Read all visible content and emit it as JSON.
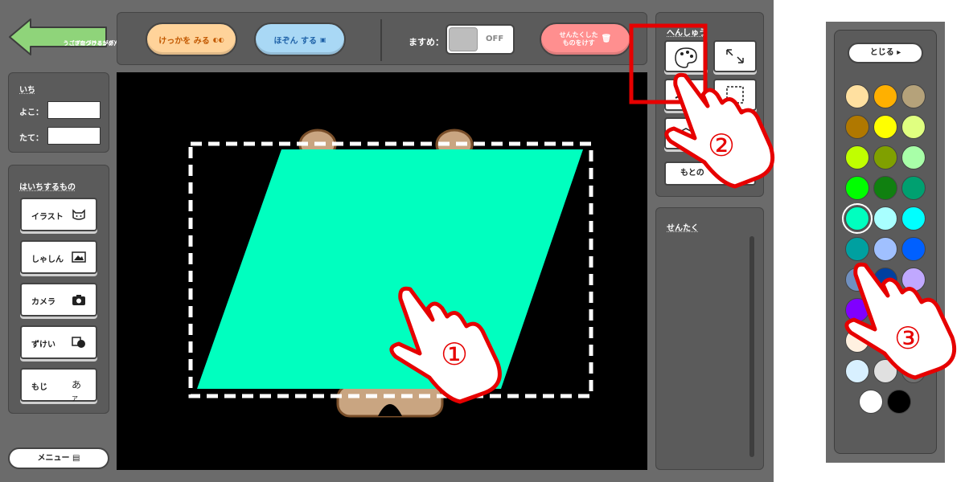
{
  "back_button": {
    "label_line1": "うごきをつけるがめんへ",
    "label_line2": "（プログラミング）"
  },
  "toolbar": {
    "result_label": "けっかを みる",
    "save_label": "ほぞん する",
    "grid_label": "ますめ：",
    "grid_state": "OFF",
    "delete_label_line1": "せんたくした",
    "delete_label_line2": "ものをけす"
  },
  "position": {
    "title": "いち",
    "x_label": "よこ：",
    "y_label": "たて：",
    "x_value": "",
    "y_value": ""
  },
  "place": {
    "title": "はいちするもの",
    "items": [
      {
        "label": "イラスト",
        "icon": "cat-icon"
      },
      {
        "label": "しゃしん",
        "icon": "photo-icon"
      },
      {
        "label": "カメラ",
        "icon": "camera-icon"
      },
      {
        "label": "ずけい",
        "icon": "shape-icon"
      },
      {
        "label": "もじ",
        "icon": "text-icon"
      }
    ]
  },
  "menu_label": "メニュー",
  "edit": {
    "title": "へんしゅう",
    "restore_label": "もとの"
  },
  "selection": {
    "title": "せんたく"
  },
  "palette": {
    "close_label": "とじる",
    "colors": [
      "#FFE0A0",
      "#FFB000",
      "#B5A27A",
      "#B07800",
      "#FFFF00",
      "#E0FF80",
      "#C0FF00",
      "#80A000",
      "#A8FFA8",
      "#00FF00",
      "#108010",
      "#00A070",
      "#00FFBF",
      "#A8FFFF",
      "#00FFFF",
      "#00A0A0",
      "#A0C0FF",
      "#0060FF",
      "#7090C0",
      "#0040A0",
      "#C0A8FF",
      "#8000FF",
      "#5050FF",
      "#FF80FF",
      "#FFF0E0",
      "#E0FFE0",
      "#F0E0FF",
      "#D8F0FF",
      "#E0E0E0",
      "#707070",
      "#FFFFFF",
      "#000000"
    ],
    "selected_color": "#00FFBF"
  },
  "canvas_shape": {
    "type": "parallelogram",
    "fill": "#00FFBF"
  },
  "annotations": {
    "step1": "①",
    "step2": "②",
    "step3": "③",
    "accent": "#E60000"
  }
}
